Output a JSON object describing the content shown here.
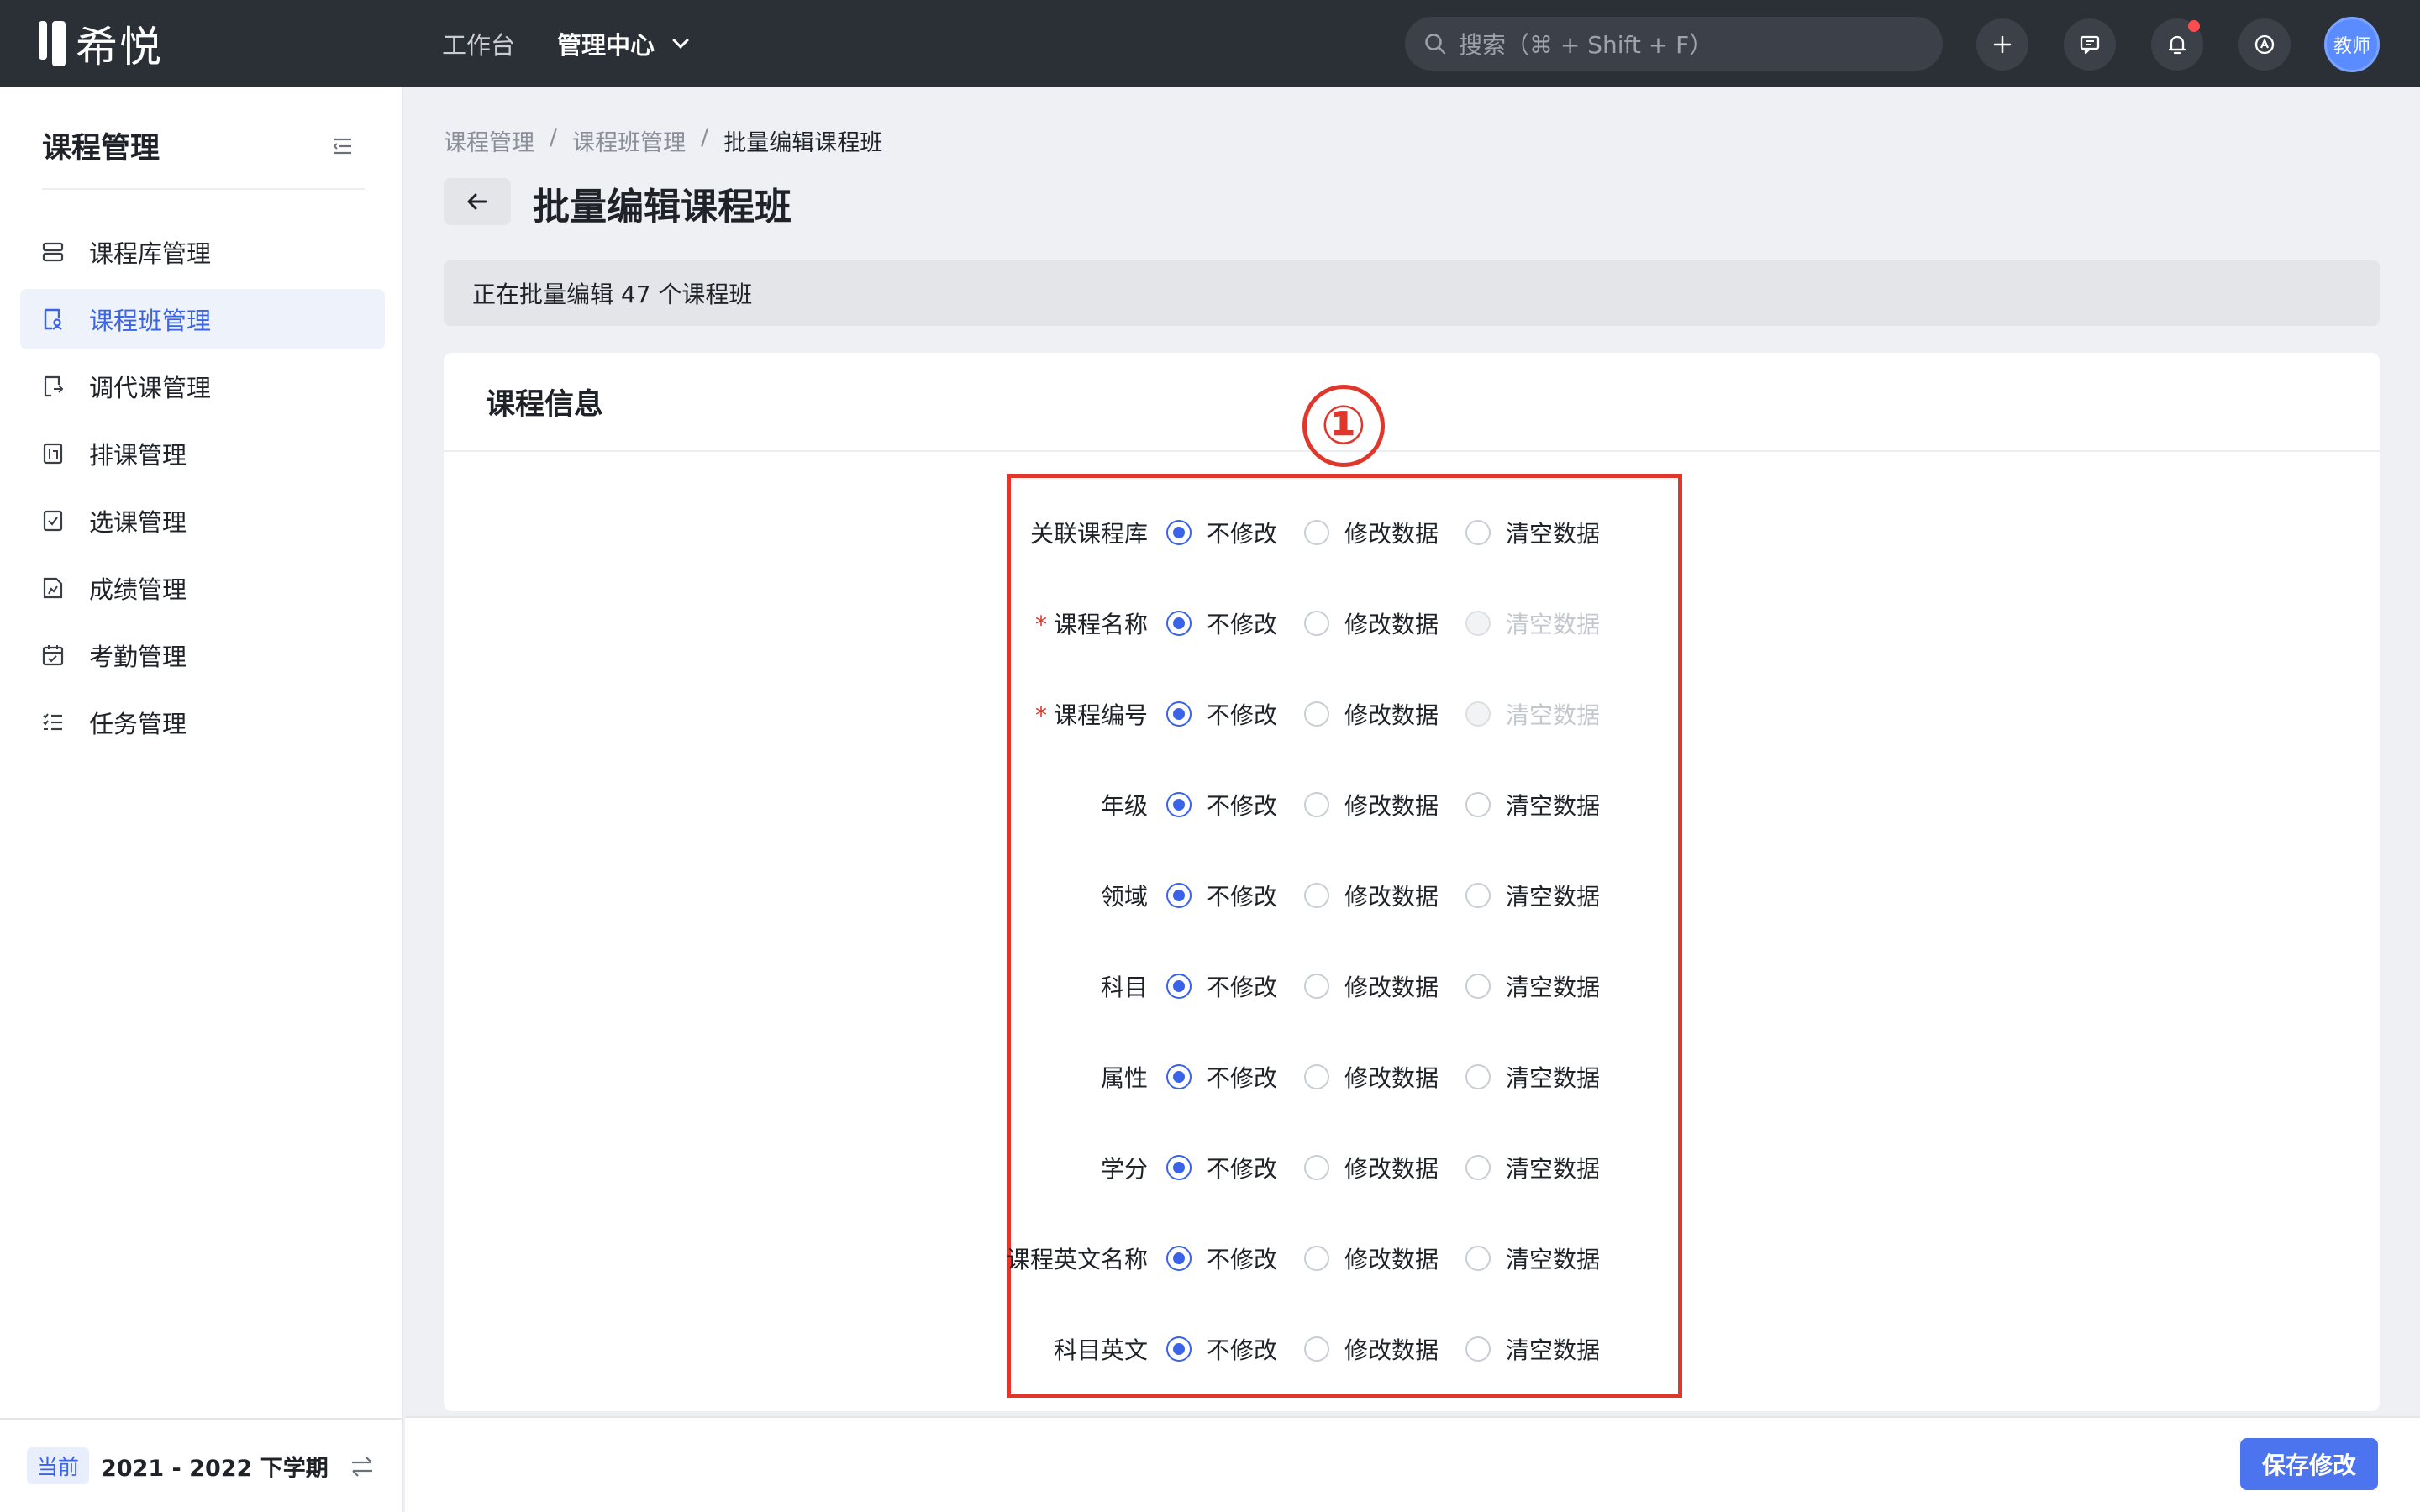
{
  "app": {
    "logo_text": "希悦"
  },
  "topnav": {
    "items": [
      "工作台",
      "管理中心"
    ]
  },
  "search": {
    "placeholder": "搜索（⌘ + Shift + F）"
  },
  "topbar_icons": [
    "plus-icon",
    "message-icon",
    "bell-icon",
    "help-icon"
  ],
  "user": {
    "avatar_text": "教师"
  },
  "sidebar": {
    "title": "课程管理",
    "items": [
      {
        "label": "课程库管理",
        "icon": "library-icon"
      },
      {
        "label": "课程班管理",
        "icon": "class-icon",
        "active": true
      },
      {
        "label": "调代课管理",
        "icon": "substitute-icon"
      },
      {
        "label": "排课管理",
        "icon": "schedule-icon"
      },
      {
        "label": "选课管理",
        "icon": "selection-icon"
      },
      {
        "label": "成绩管理",
        "icon": "grade-icon"
      },
      {
        "label": "考勤管理",
        "icon": "attendance-icon"
      },
      {
        "label": "任务管理",
        "icon": "task-icon"
      }
    ],
    "term_badge": "当前",
    "term_text": "2021 - 2022 下学期"
  },
  "breadcrumb": [
    "课程管理",
    "课程班管理",
    "批量编辑课程班"
  ],
  "breadcrumb_sep": "/",
  "page": {
    "title": "批量编辑课程班",
    "notice": "正在批量编辑 47 个课程班"
  },
  "card": {
    "title": "课程信息"
  },
  "annotation": {
    "marker": "①"
  },
  "options": {
    "keep": "不修改",
    "modify": "修改数据",
    "clear": "清空数据"
  },
  "fields": [
    {
      "label": "关联课程库",
      "required": false,
      "clear_disabled": false
    },
    {
      "label": "课程名称",
      "required": true,
      "clear_disabled": true
    },
    {
      "label": "课程编号",
      "required": true,
      "clear_disabled": true
    },
    {
      "label": "年级",
      "required": false,
      "clear_disabled": false
    },
    {
      "label": "领域",
      "required": false,
      "clear_disabled": false
    },
    {
      "label": "科目",
      "required": false,
      "clear_disabled": false
    },
    {
      "label": "属性",
      "required": false,
      "clear_disabled": false
    },
    {
      "label": "学分",
      "required": false,
      "clear_disabled": false
    },
    {
      "label": "课程英文名称",
      "required": false,
      "clear_disabled": false
    },
    {
      "label": "科目英文",
      "required": false,
      "clear_disabled": false
    }
  ],
  "footer": {
    "save_label": "保存修改"
  },
  "colors": {
    "accent": "#3b63e8",
    "topbar": "#2b2f36",
    "annotation": "#e0362c"
  }
}
